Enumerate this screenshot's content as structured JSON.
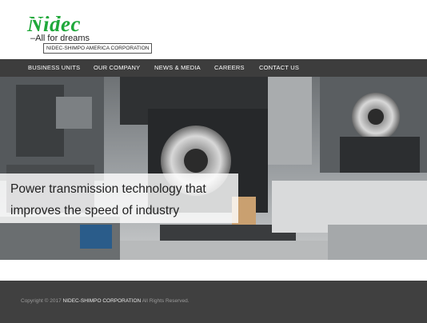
{
  "header": {
    "logo_text": "Nidec",
    "tagline": "All for dreams",
    "subsidiary": "NIDEC-SHIMPO AMERICA CORPORATION"
  },
  "nav": {
    "items": [
      {
        "label": "BUSINESS UNITS"
      },
      {
        "label": "OUR COMPANY"
      },
      {
        "label": "NEWS & MEDIA"
      },
      {
        "label": "CAREERS"
      },
      {
        "label": "CONTACT US"
      }
    ]
  },
  "hero": {
    "caption_line1": "Power transmission technology that",
    "caption_line2": "improves the speed of industry"
  },
  "footer": {
    "copyright_prefix": "Copyright © 2017",
    "company": "NIDEC-SHIMPO CORPORATION",
    "rights": "All Rights Reserved."
  },
  "colors": {
    "brand_green": "#1fa83a",
    "nav_bg": "#3d3d3d",
    "footer_bg": "#404040"
  }
}
